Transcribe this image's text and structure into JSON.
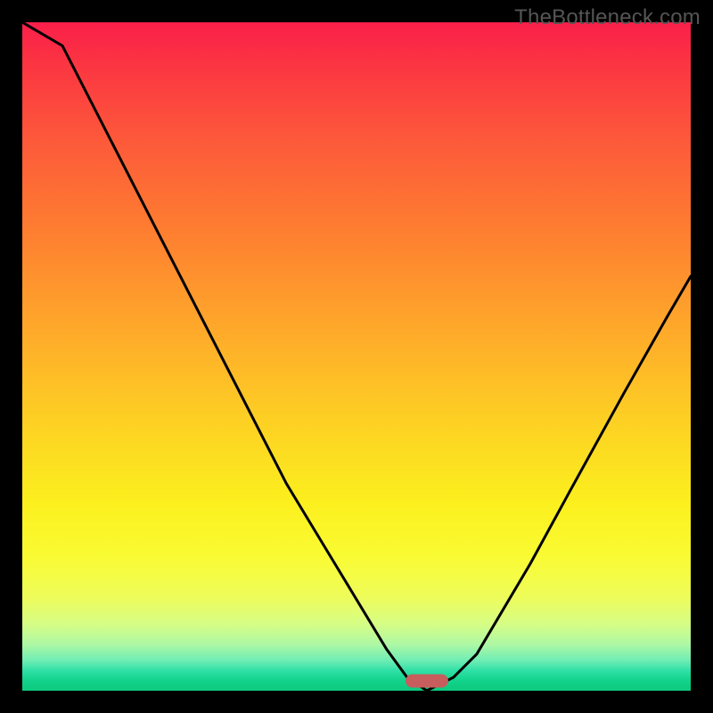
{
  "watermark": "TheBottleneck.com",
  "chart_data": {
    "type": "line",
    "title": "",
    "xlabel": "",
    "ylabel": "",
    "series": [
      {
        "name": "bottleneck-curve",
        "x": [
          0.0,
          0.06,
          0.395,
          0.545,
          0.575,
          0.605,
          0.645,
          0.68,
          0.76,
          0.82,
          0.9,
          0.965,
          1.0
        ],
        "values": [
          1.0,
          0.965,
          0.31,
          0.062,
          0.021,
          0.0,
          0.02,
          0.055,
          0.19,
          0.3,
          0.445,
          0.56,
          0.62
        ]
      }
    ],
    "xlim": [
      0,
      1
    ],
    "ylim": [
      0,
      1
    ],
    "minimum_x": 0.605,
    "marker": {
      "x_frac": 0.605,
      "y_frac": 0.985
    },
    "gradient_stops": [
      {
        "pos": 0.0,
        "color": "#fa1f4a"
      },
      {
        "pos": 0.5,
        "color": "#fecb25"
      },
      {
        "pos": 0.85,
        "color": "#f3fc48"
      },
      {
        "pos": 1.0,
        "color": "#0cc97d"
      }
    ]
  },
  "colors": {
    "background": "#000000",
    "curve": "#000000",
    "marker": "#c85d5d",
    "watermark": "#555555"
  }
}
